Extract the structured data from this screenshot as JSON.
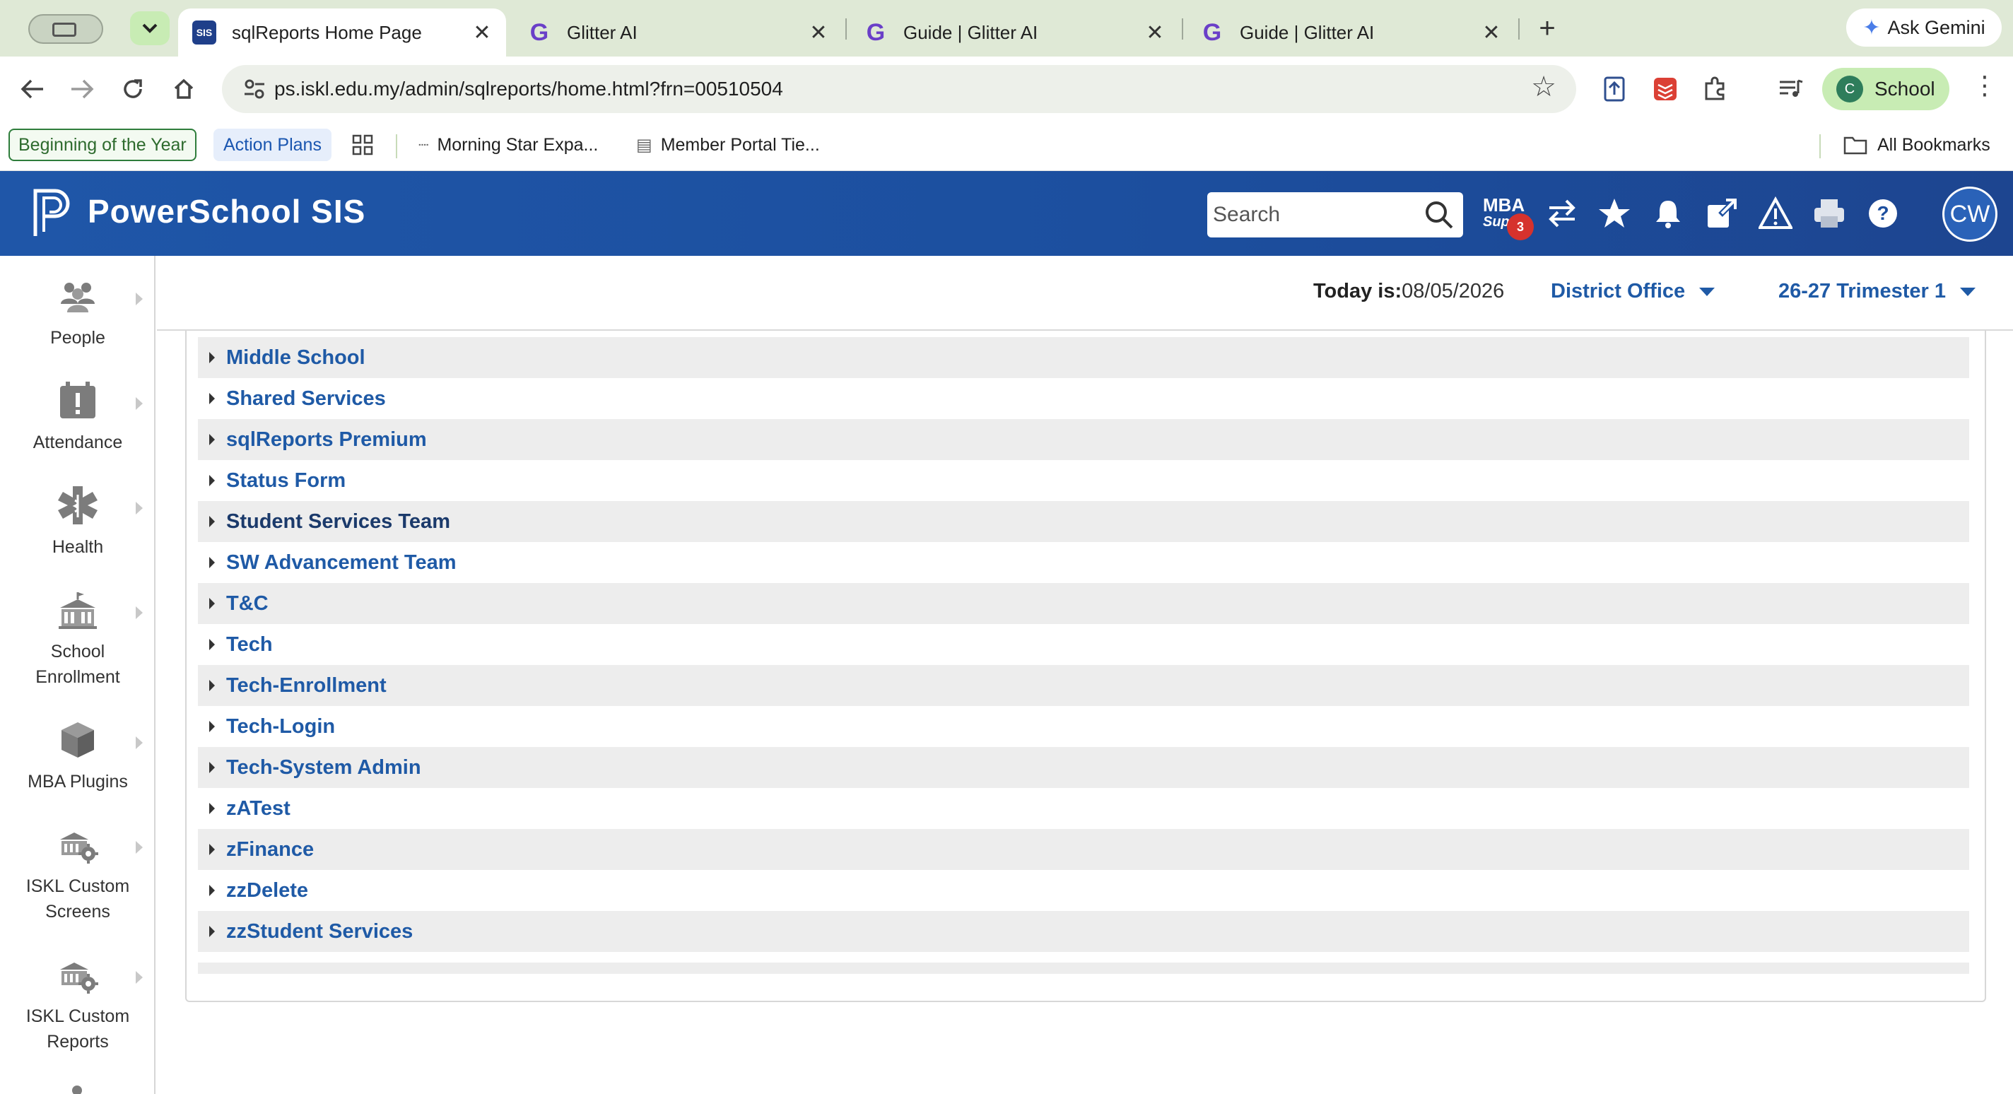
{
  "browser": {
    "tabs": [
      {
        "title": "sqlReports Home Page",
        "favicon": "SIS",
        "active": true
      },
      {
        "title": "Glitter AI",
        "favicon": "G",
        "active": false
      },
      {
        "title": "Guide | Glitter AI",
        "favicon": "G",
        "active": false
      },
      {
        "title": "Guide | Glitter AI",
        "favicon": "G",
        "active": false
      }
    ],
    "ask_gemini": "Ask Gemini",
    "url": "ps.iskl.edu.my/admin/sqlreports/home.html?frn=00510504",
    "profile_initial": "C",
    "profile_label": "School",
    "bookmarks": [
      {
        "label": "Beginning of the Year"
      },
      {
        "label": "Action Plans"
      },
      {
        "label": "Morning Star Expa..."
      },
      {
        "label": "Member Portal Tie..."
      }
    ],
    "all_bookmarks": "All Bookmarks"
  },
  "ps": {
    "brand": "PowerSchool SIS",
    "search_placeholder": "Search",
    "mba_top": "MBA",
    "mba_sub": "Supp",
    "mba_badge": "3",
    "user_initials": "CW",
    "today_label": "Today is:",
    "today_date": "08/05/2026",
    "school": "District Office",
    "term": "26-27 Trimester 1"
  },
  "nav": [
    {
      "label": "People",
      "icon": "people-icon"
    },
    {
      "label": "Attendance",
      "icon": "attendance-icon"
    },
    {
      "label": "Health",
      "icon": "health-icon"
    },
    {
      "label": "School Enrollment",
      "icon": "school-enrollment-icon"
    },
    {
      "label": "MBA Plugins",
      "icon": "plugins-icon"
    },
    {
      "label": "ISKL Custom Screens",
      "icon": "custom-screens-icon"
    },
    {
      "label": "ISKL Custom Reports",
      "icon": "custom-reports-icon"
    }
  ],
  "report_groups": [
    "Middle School",
    "Shared Services",
    "sqlReports Premium",
    "Status Form",
    "Student Services Team",
    "SW Advancement Team",
    "T&C",
    "Tech",
    "Tech-Enrollment",
    "Tech-Login",
    "Tech-System Admin",
    "zATest",
    "zFinance",
    "zzDelete",
    "zzStudent Services"
  ],
  "colors": {
    "header_blue": "#1f56a8",
    "link_blue": "#1f5aa6",
    "row_shade": "#ededed",
    "badge_red": "#d6322d"
  }
}
